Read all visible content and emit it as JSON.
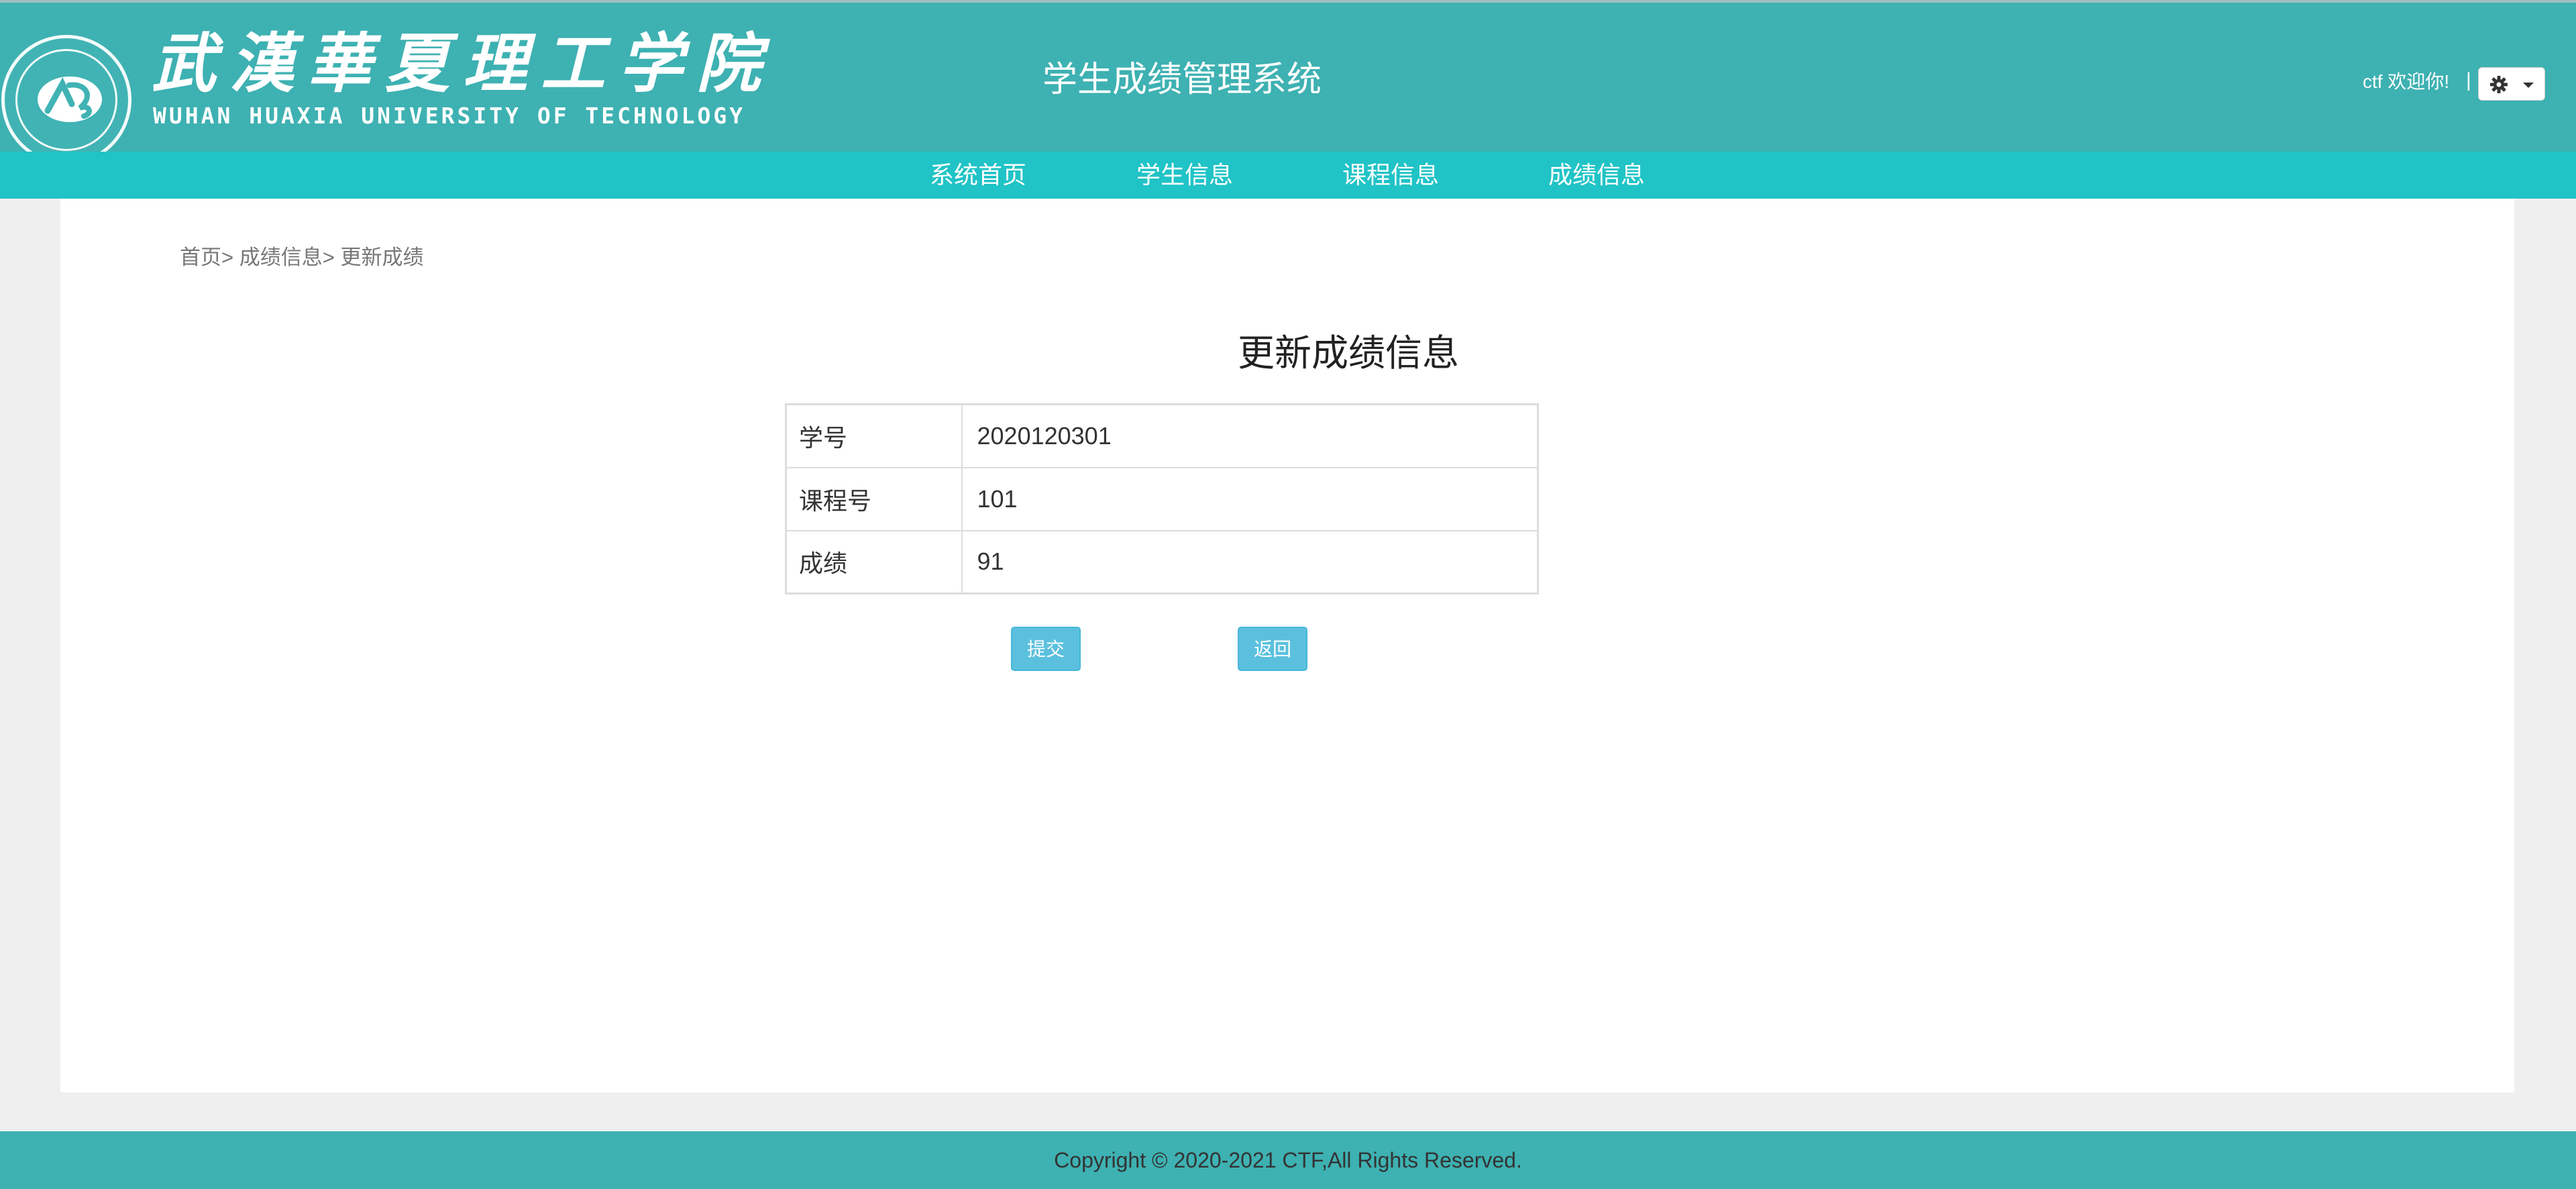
{
  "header": {
    "logo_cn": "武漢華夏理工学院",
    "logo_en": "WUHAN HUAXIA UNIVERSITY OF TECHNOLOGY",
    "system_title": "学生成绩管理系统",
    "welcome": "ctf 欢迎你!",
    "separator": "|",
    "settings_icon": "gear-icon",
    "colors": {
      "header_bg": "#3eb1b2",
      "nav_bg": "#20c3c6",
      "button_info": "#5bc0de"
    }
  },
  "nav": {
    "items": [
      {
        "label": "系统首页"
      },
      {
        "label": "学生信息"
      },
      {
        "label": "课程信息"
      },
      {
        "label": "成绩信息"
      }
    ]
  },
  "breadcrumb": {
    "home": "首页",
    "sep1": ">",
    "section": "成绩信息",
    "sep2": ">",
    "current": "更新成绩"
  },
  "form": {
    "title": "更新成绩信息",
    "rows": [
      {
        "label": "学号",
        "value": "2020120301"
      },
      {
        "label": "课程号",
        "value": "101"
      },
      {
        "label": "成绩",
        "value": "91"
      }
    ],
    "submit_label": "提交",
    "back_label": "返回"
  },
  "footer": {
    "copyright": "Copyright © 2020-2021 CTF,All Rights Reserved."
  }
}
